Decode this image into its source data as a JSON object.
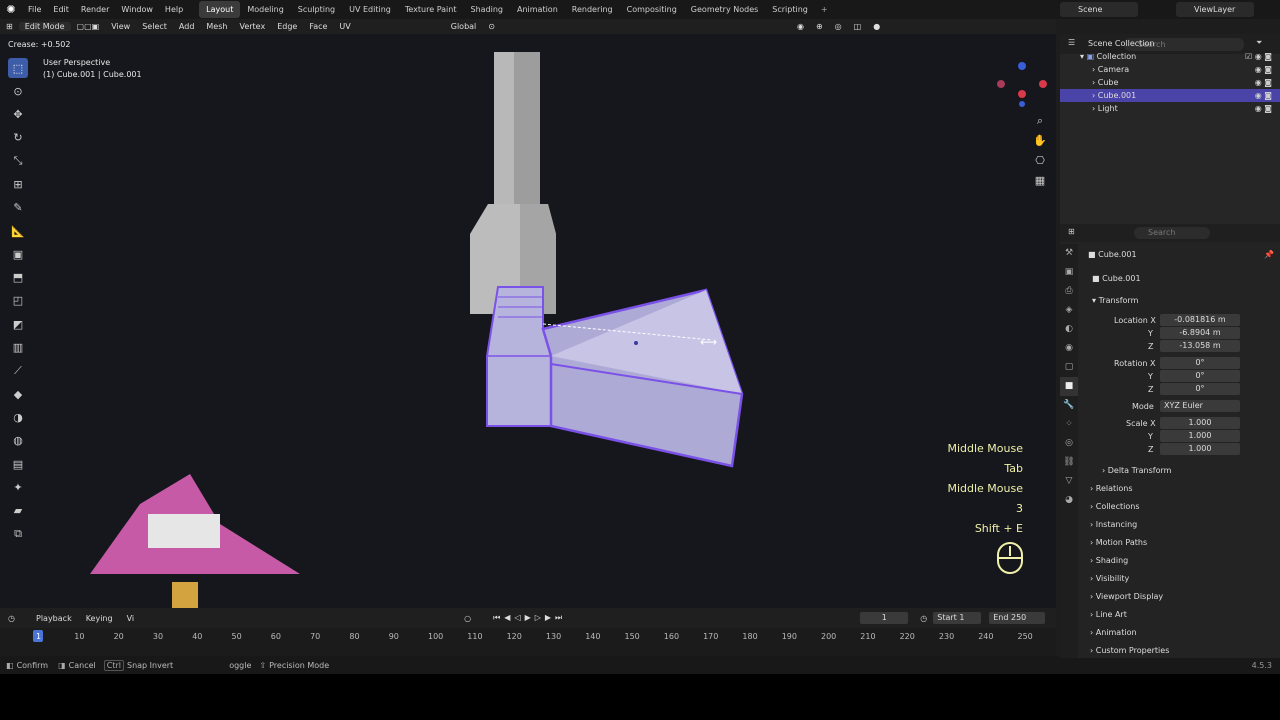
{
  "menu": {
    "file": "File",
    "edit": "Edit",
    "render": "Render",
    "window": "Window",
    "help": "Help"
  },
  "workspaces": [
    "Layout",
    "Modeling",
    "Sculpting",
    "UV Editing",
    "Texture Paint",
    "Shading",
    "Animation",
    "Rendering",
    "Compositing",
    "Geometry Nodes",
    "Scripting"
  ],
  "scene": "Scene",
  "view_layer": "ViewLayer",
  "header": {
    "mode": "Edit Mode",
    "view": "View",
    "select": "Select",
    "add": "Add",
    "mesh": "Mesh",
    "vertex": "Vertex",
    "edge": "Edge",
    "face": "Face",
    "uv": "UV",
    "orientation": "Global"
  },
  "crease_status": "Crease: +0.502",
  "viewport": {
    "perspective": "User Perspective",
    "object_info": "(1) Cube.001 | Cube.001"
  },
  "keystrokes": [
    "Middle Mouse",
    "Tab",
    "Middle Mouse",
    "3",
    "Shift + E"
  ],
  "outliner": {
    "search_placeholder": "Search",
    "scene_collection": "Scene Collection",
    "collection": "Collection",
    "items": [
      "Camera",
      "Cube",
      "Cube.001",
      "Light"
    ]
  },
  "properties": {
    "search_placeholder": "Search",
    "object_name": "Cube.001",
    "object_field": "Cube.001",
    "transform": "Transform",
    "location_label": "Location X",
    "loc_x": "-0.081816 m",
    "loc_y": "-6.8904 m",
    "loc_z": "-13.058 m",
    "rotation_label": "Rotation X",
    "rot_x": "0°",
    "rot_y": "0°",
    "rot_z": "0°",
    "mode_label": "Mode",
    "mode_value": "XYZ Euler",
    "scale_label": "Scale X",
    "scale_x": "1.000",
    "scale_y": "1.000",
    "scale_z": "1.000",
    "axis_y": "Y",
    "axis_z": "Z",
    "panels": [
      "Delta Transform",
      "Relations",
      "Collections",
      "Instancing",
      "Motion Paths",
      "Shading",
      "Visibility",
      "Viewport Display",
      "Line Art",
      "Animation",
      "Custom Properties"
    ]
  },
  "timeline": {
    "playback": "Playback",
    "keying": "Keying",
    "view": "Vi",
    "current_frame": "1",
    "start_label": "Start",
    "start": "1",
    "end_label": "End",
    "end": "250",
    "ticks": [
      "1",
      "10",
      "20",
      "30",
      "40",
      "50",
      "60",
      "70",
      "80",
      "90",
      "100",
      "110",
      "120",
      "130",
      "140",
      "150",
      "160",
      "170",
      "180",
      "190",
      "200",
      "210",
      "220",
      "230",
      "240",
      "250"
    ]
  },
  "status": {
    "confirm": "Confirm",
    "cancel": "Cancel",
    "ctrl": "Ctrl",
    "snap_invert": "Snap Invert",
    "toggle": "oggle",
    "precision": "Precision Mode",
    "version": "4.5.3"
  },
  "colors": {
    "accent": "#4a44a8",
    "selection": "#7b52e8",
    "mesh": "#b6b3dc",
    "keystroke": "#f0f0a8"
  }
}
